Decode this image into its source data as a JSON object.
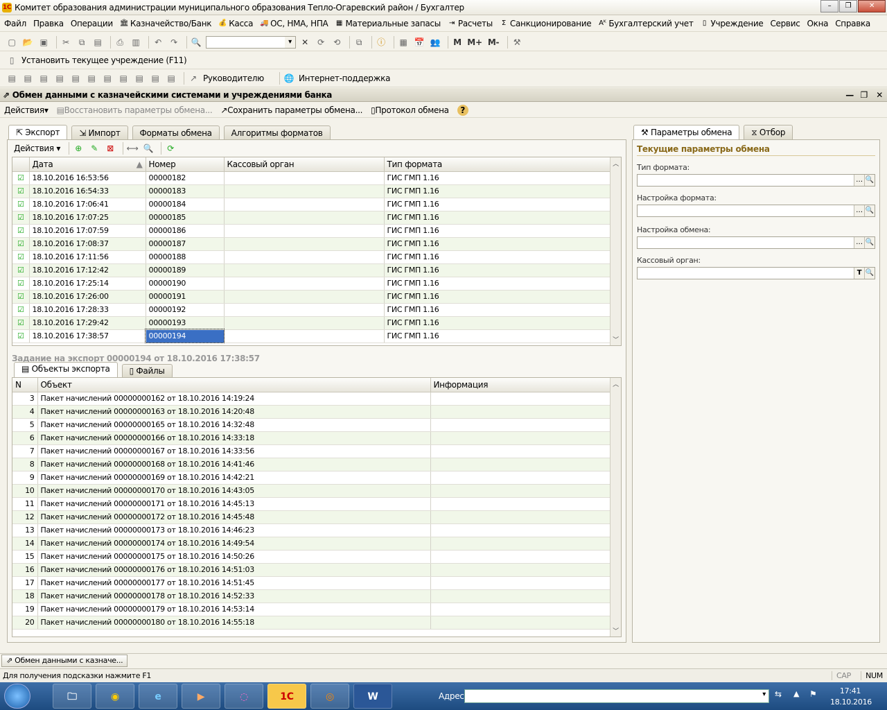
{
  "window": {
    "title": "Комитет образования администрации муниципального образования Тепло-Огаревский район / Бухгалтер"
  },
  "menu": [
    "Файл",
    "Правка",
    "Операции",
    "Казначейство/Банк",
    "Касса",
    "ОС, НМА, НПА",
    "Материальные запасы",
    "Расчеты",
    "Санкционирование",
    "Бухгалтерский учет",
    "Учреждение",
    "Сервис",
    "Окна",
    "Справка"
  ],
  "toolbar3": {
    "set_institution": "Установить текущее учреждение (F11)"
  },
  "toolbar4": {
    "manager": "Руководителю",
    "support": "Интернет-поддержка"
  },
  "toolbar2": {
    "m": "M",
    "mplus": "M+",
    "mminus": "M-"
  },
  "doc": {
    "title": "Обмен данными с казначейскими системами и учреждениями банка",
    "actions": "Действия",
    "restore": "Восстановить параметры обмена...",
    "save": "Сохранить параметры обмена...",
    "protocol": "Протокол обмена",
    "help": "?"
  },
  "tabs": [
    "Экспорт",
    "Импорт",
    "Форматы обмена",
    "Алгоритмы форматов"
  ],
  "grid_actions": "Действия",
  "export_table": {
    "headers": [
      "Дата",
      "Номер",
      "Кассовый орган",
      "Тип формата"
    ],
    "rows": [
      [
        "18.10.2016 16:53:56",
        "00000182",
        "",
        "ГИС ГМП 1.16"
      ],
      [
        "18.10.2016 16:54:33",
        "00000183",
        "",
        "ГИС ГМП 1.16"
      ],
      [
        "18.10.2016 17:06:41",
        "00000184",
        "",
        "ГИС ГМП 1.16"
      ],
      [
        "18.10.2016 17:07:25",
        "00000185",
        "",
        "ГИС ГМП 1.16"
      ],
      [
        "18.10.2016 17:07:59",
        "00000186",
        "",
        "ГИС ГМП 1.16"
      ],
      [
        "18.10.2016 17:08:37",
        "00000187",
        "",
        "ГИС ГМП 1.16"
      ],
      [
        "18.10.2016 17:11:56",
        "00000188",
        "",
        "ГИС ГМП 1.16"
      ],
      [
        "18.10.2016 17:12:42",
        "00000189",
        "",
        "ГИС ГМП 1.16"
      ],
      [
        "18.10.2016 17:25:14",
        "00000190",
        "",
        "ГИС ГМП 1.16"
      ],
      [
        "18.10.2016 17:26:00",
        "00000191",
        "",
        "ГИС ГМП 1.16"
      ],
      [
        "18.10.2016 17:28:33",
        "00000192",
        "",
        "ГИС ГМП 1.16"
      ],
      [
        "18.10.2016 17:29:42",
        "00000193",
        "",
        "ГИС ГМП 1.16"
      ],
      [
        "18.10.2016 17:38:57",
        "00000194",
        "",
        "ГИС ГМП 1.16"
      ]
    ]
  },
  "task_title": "Задание на экспорт 00000194 от 18.10.2016 17:38:57",
  "subtabs": [
    "Объекты экспорта",
    "Файлы"
  ],
  "objects_table": {
    "headers": [
      "N",
      "Объект",
      "Информация"
    ],
    "rows": [
      [
        "3",
        "Пакет начислений 00000000162 от 18.10.2016 14:19:24",
        ""
      ],
      [
        "4",
        "Пакет начислений 00000000163 от 18.10.2016 14:20:48",
        ""
      ],
      [
        "5",
        "Пакет начислений 00000000165 от 18.10.2016 14:32:48",
        ""
      ],
      [
        "6",
        "Пакет начислений 00000000166 от 18.10.2016 14:33:18",
        ""
      ],
      [
        "7",
        "Пакет начислений 00000000167 от 18.10.2016 14:33:56",
        ""
      ],
      [
        "8",
        "Пакет начислений 00000000168 от 18.10.2016 14:41:46",
        ""
      ],
      [
        "9",
        "Пакет начислений 00000000169 от 18.10.2016 14:42:21",
        ""
      ],
      [
        "10",
        "Пакет начислений 00000000170 от 18.10.2016 14:43:05",
        ""
      ],
      [
        "11",
        "Пакет начислений 00000000171 от 18.10.2016 14:45:13",
        ""
      ],
      [
        "12",
        "Пакет начислений 00000000172 от 18.10.2016 14:45:48",
        ""
      ],
      [
        "13",
        "Пакет начислений 00000000173 от 18.10.2016 14:46:23",
        ""
      ],
      [
        "14",
        "Пакет начислений 00000000174 от 18.10.2016 14:49:54",
        ""
      ],
      [
        "15",
        "Пакет начислений 00000000175 от 18.10.2016 14:50:26",
        ""
      ],
      [
        "16",
        "Пакет начислений 00000000176 от 18.10.2016 14:51:03",
        ""
      ],
      [
        "17",
        "Пакет начислений 00000000177 от 18.10.2016 14:51:45",
        ""
      ],
      [
        "18",
        "Пакет начислений 00000000178 от 18.10.2016 14:52:33",
        ""
      ],
      [
        "19",
        "Пакет начислений 00000000179 от 18.10.2016 14:53:14",
        ""
      ],
      [
        "20",
        "Пакет начислений 00000000180 от 18.10.2016 14:55:18",
        ""
      ]
    ]
  },
  "right": {
    "tabs": [
      "Параметры обмена",
      "Отбор"
    ],
    "heading": "Текущие параметры обмена",
    "fields": [
      "Тип формата:",
      "Настройка формата:",
      "Настройка обмена:",
      "Кассовый орган:"
    ]
  },
  "window_tab": "Обмен данными с казначе...",
  "status": {
    "hint": "Для получения подсказки нажмите F1",
    "cap": "CAP",
    "num": "NUM"
  },
  "taskbar": {
    "address_label": "Адрес",
    "time": "17:41",
    "date": "18.10.2016"
  }
}
